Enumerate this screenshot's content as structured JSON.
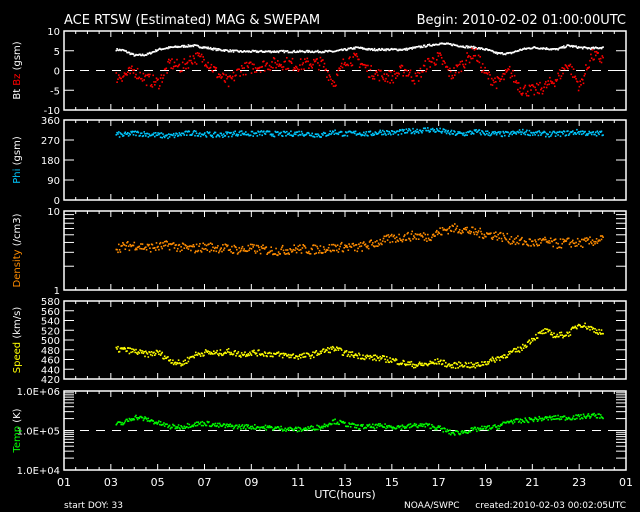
{
  "title": "ACE RTSW (Estimated) MAG & SWEPAM",
  "begin": "Begin: 2010-02-02 01:00:00UTC",
  "xlabel": "UTC(hours)",
  "start_doy": "start DOY:  33",
  "source": "NOAA/SWPC",
  "created": "created:2010-02-03 00:02:05UTC",
  "x_tick_labels": [
    "01",
    "03",
    "05",
    "07",
    "09",
    "11",
    "13",
    "15",
    "17",
    "19",
    "21",
    "23",
    "01"
  ],
  "x_tick_hours": [
    1,
    3,
    5,
    7,
    9,
    11,
    13,
    15,
    17,
    19,
    21,
    23,
    25
  ],
  "chart_data": [
    {
      "type": "scatter",
      "panel": "mag",
      "ylabel_parts": [
        {
          "text": "Bt",
          "color": "#ffffff"
        },
        {
          "text": "Bz",
          "color": "#ff0000"
        },
        {
          "text": "(gsm)",
          "color": "#ffffff"
        }
      ],
      "ylim": [
        -10,
        10
      ],
      "log": false,
      "yticks": [
        10,
        5,
        0,
        -5,
        -10
      ],
      "ytick_labels": [
        "10",
        "5",
        "0",
        "-5",
        "-10"
      ],
      "dashed_at": 0,
      "x": [
        3.2,
        3.5,
        4,
        4.5,
        5,
        5.5,
        6,
        6.5,
        7,
        7.5,
        8,
        8.5,
        9,
        9.5,
        10,
        10.5,
        11,
        11.5,
        12,
        12.5,
        13,
        13.5,
        14,
        14.5,
        15,
        15.5,
        16,
        16.5,
        17,
        17.5,
        18,
        18.5,
        19,
        19.5,
        20,
        20.5,
        21,
        21.5,
        22,
        22.5,
        23,
        23.5,
        24
      ],
      "series": [
        {
          "name": "Bt",
          "color": "#ffffff",
          "values": [
            5.5,
            5.3,
            4,
            4.2,
            5.5,
            6,
            6.3,
            6.5,
            6,
            5.5,
            5.2,
            5,
            5,
            5,
            5,
            5,
            5,
            5,
            5,
            5,
            5.5,
            6,
            5.5,
            5.5,
            5.5,
            5.5,
            6,
            6.5,
            7,
            6.8,
            6.3,
            6,
            5.5,
            4.5,
            4.5,
            5.5,
            6,
            5.8,
            5.5,
            6.5,
            6,
            5.8,
            6
          ]
        },
        {
          "name": "Bz",
          "color": "#ff0000",
          "values": [
            -1.5,
            -1,
            0,
            -2,
            -3,
            2,
            1,
            3.5,
            3,
            -0.5,
            -3,
            0.5,
            1,
            1.5,
            2,
            2,
            1.5,
            2,
            2,
            -3,
            3,
            3,
            0,
            -1,
            -1.5,
            0.5,
            -2,
            2,
            3.5,
            -1,
            2,
            5,
            -1,
            -3,
            0,
            -4.5,
            -5,
            -4,
            -2,
            2,
            -4,
            4,
            3
          ]
        }
      ]
    },
    {
      "type": "scatter",
      "panel": "phi",
      "ylabel_parts": [
        {
          "text": "Phi",
          "color": "#00c8ff"
        },
        {
          "text": "(gsm)",
          "color": "#ffffff"
        }
      ],
      "ylim": [
        0,
        360
      ],
      "log": false,
      "yticks": [
        360,
        270,
        180,
        90,
        0
      ],
      "ytick_labels": [
        "360",
        "270",
        "180",
        "90",
        "0"
      ],
      "x": [
        3.2,
        3.5,
        4,
        4.5,
        5,
        5.5,
        6,
        6.5,
        7,
        7.5,
        8,
        8.5,
        9,
        9.5,
        10,
        10.5,
        11,
        11.5,
        12,
        12.5,
        13,
        13.5,
        14,
        14.5,
        15,
        15.5,
        16,
        16.5,
        17,
        17.5,
        18,
        18.5,
        19,
        19.5,
        20,
        20.5,
        21,
        21.5,
        22,
        22.5,
        23,
        23.5,
        24
      ],
      "series": [
        {
          "name": "Phi",
          "color": "#00c8ff",
          "values": [
            300,
            295,
            305,
            300,
            295,
            290,
            300,
            305,
            300,
            295,
            300,
            305,
            300,
            305,
            300,
            300,
            305,
            300,
            295,
            310,
            300,
            305,
            300,
            310,
            305,
            310,
            315,
            320,
            315,
            305,
            300,
            310,
            305,
            300,
            300,
            310,
            305,
            300,
            300,
            305,
            310,
            300,
            305
          ]
        }
      ]
    },
    {
      "type": "scatter",
      "panel": "density",
      "ylabel_parts": [
        {
          "text": "Density",
          "color": "#ff8c00"
        },
        {
          "text": "(/cm3)",
          "color": "#ffffff"
        }
      ],
      "ylim": [
        1,
        10
      ],
      "log": true,
      "yticks": [
        10,
        1
      ],
      "ytick_labels": [
        "10",
        "1"
      ],
      "x": [
        3.2,
        3.5,
        4,
        4.5,
        5,
        5.5,
        6,
        6.5,
        7,
        7.5,
        8,
        8.5,
        9,
        9.5,
        10,
        10.5,
        11,
        11.5,
        12,
        12.5,
        13,
        13.5,
        14,
        14.5,
        15,
        15.5,
        16,
        16.5,
        17,
        17.5,
        18,
        18.5,
        19,
        19.5,
        20,
        20.5,
        21,
        21.5,
        22,
        22.5,
        23,
        23.5,
        24
      ],
      "series": [
        {
          "name": "Density",
          "color": "#ff8c00",
          "values": [
            3.5,
            3.6,
            3.8,
            3.5,
            3.6,
            3.8,
            3.5,
            3.4,
            3.6,
            3.5,
            3.4,
            3.3,
            3.4,
            3.3,
            3.2,
            3.3,
            3.4,
            3.3,
            3.4,
            3.5,
            3.6,
            3.5,
            3.8,
            4.2,
            4.6,
            4.8,
            5,
            4.8,
            5.5,
            6.2,
            6,
            5.5,
            5.2,
            5,
            4.5,
            4.2,
            4.0,
            4.2,
            3.9,
            4.1,
            4.0,
            4.2,
            4.5
          ]
        }
      ]
    },
    {
      "type": "scatter",
      "panel": "speed",
      "ylabel_parts": [
        {
          "text": "Speed",
          "color": "#ffff00"
        },
        {
          "text": "(km/s)",
          "color": "#ffffff"
        }
      ],
      "ylim": [
        420,
        580
      ],
      "log": false,
      "yticks": [
        580,
        560,
        540,
        520,
        500,
        480,
        460,
        440,
        420
      ],
      "ytick_labels": [
        "580",
        "560",
        "540",
        "520",
        "500",
        "480",
        "460",
        "440",
        "420"
      ],
      "x": [
        3.2,
        3.5,
        4,
        4.5,
        5,
        5.5,
        6,
        6.5,
        7,
        7.5,
        8,
        8.5,
        9,
        9.5,
        10,
        10.5,
        11,
        11.5,
        12,
        12.5,
        13,
        13.5,
        14,
        14.5,
        15,
        15.5,
        16,
        16.5,
        17,
        17.5,
        18,
        18.5,
        19,
        19.5,
        20,
        20.5,
        21,
        21.5,
        22,
        22.5,
        23,
        23.5,
        24
      ],
      "series": [
        {
          "name": "Speed",
          "color": "#ffff00",
          "values": [
            482,
            482,
            478,
            472,
            476,
            460,
            452,
            470,
            476,
            474,
            478,
            472,
            476,
            474,
            472,
            470,
            468,
            470,
            478,
            484,
            474,
            470,
            466,
            464,
            460,
            454,
            450,
            452,
            458,
            448,
            452,
            448,
            456,
            464,
            474,
            484,
            505,
            520,
            510,
            514,
            535,
            525,
            515
          ]
        }
      ]
    },
    {
      "type": "scatter",
      "panel": "temp",
      "ylabel_parts": [
        {
          "text": "Temp",
          "color": "#00ff00"
        },
        {
          "text": "(K)",
          "color": "#ffffff"
        }
      ],
      "ylim": [
        10000,
        1000000
      ],
      "log": true,
      "yticks": [
        1000000,
        100000,
        10000
      ],
      "ytick_labels": [
        "1.0E+06",
        "1.0E+05",
        "1.0E+04"
      ],
      "dashed_at": 100000,
      "x": [
        3.2,
        3.5,
        4,
        4.5,
        5,
        5.5,
        6,
        6.5,
        7,
        7.5,
        8,
        8.5,
        9,
        9.5,
        10,
        10.5,
        11,
        11.5,
        12,
        12.5,
        13,
        13.5,
        14,
        14.5,
        15,
        15.5,
        16,
        16.5,
        17,
        17.5,
        18,
        18.5,
        19,
        19.5,
        20,
        20.5,
        21,
        21.5,
        22,
        22.5,
        23,
        23.5,
        24
      ],
      "series": [
        {
          "name": "Temp",
          "color": "#00ff00",
          "values": [
            150000,
            160000,
            230000,
            200000,
            160000,
            130000,
            130000,
            150000,
            160000,
            140000,
            135000,
            130000,
            130000,
            125000,
            120000,
            115000,
            110000,
            120000,
            130000,
            180000,
            150000,
            130000,
            130000,
            135000,
            130000,
            130000,
            140000,
            140000,
            120000,
            90000,
            95000,
            110000,
            120000,
            130000,
            180000,
            180000,
            200000,
            210000,
            220000,
            220000,
            230000,
            250000,
            240000
          ]
        }
      ]
    }
  ]
}
